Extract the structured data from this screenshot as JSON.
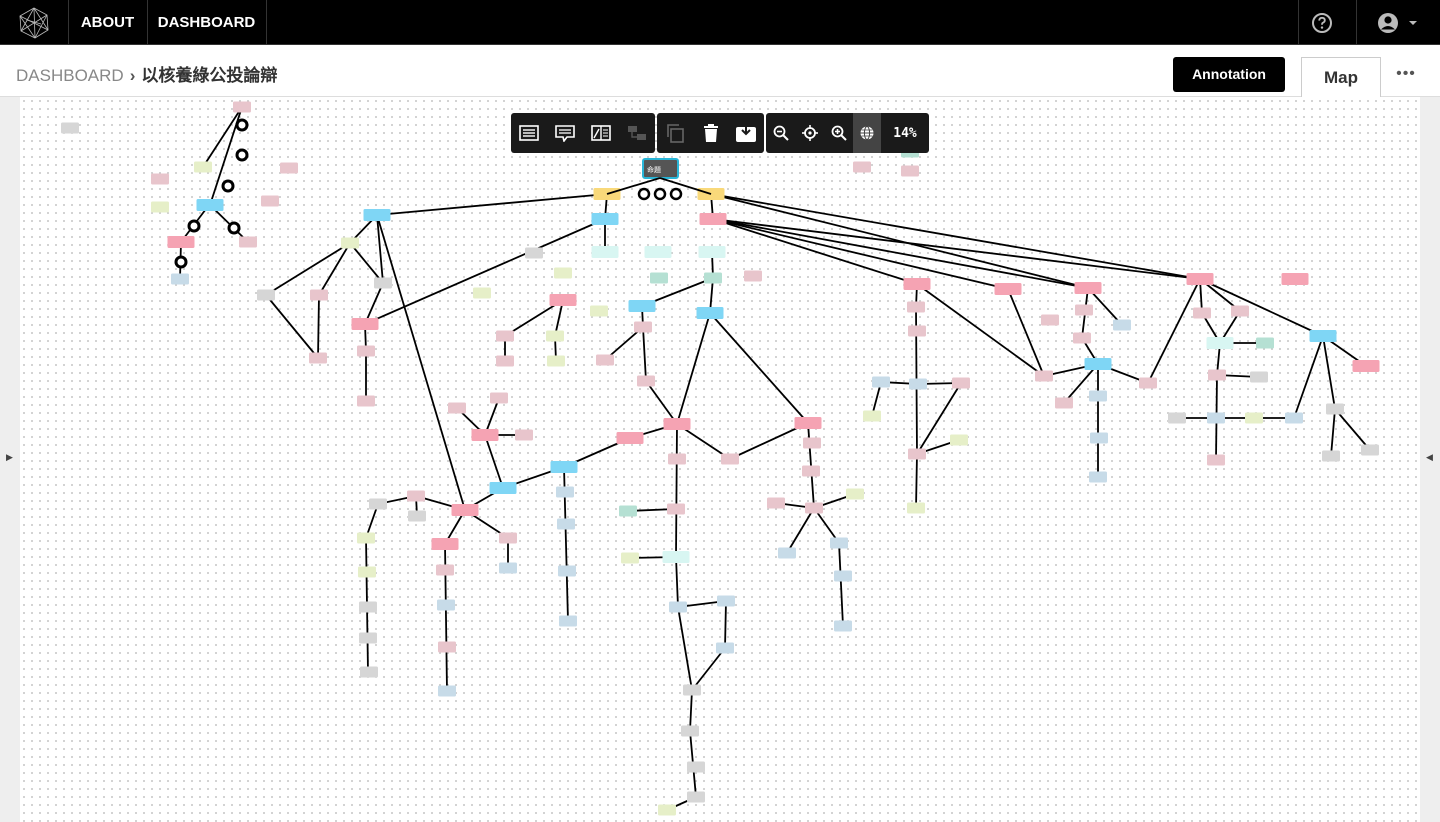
{
  "nav": {
    "logo": "network-logo-icon",
    "items": [
      {
        "label": "ABOUT"
      },
      {
        "label": "DASHBOARD"
      }
    ],
    "help_icon": "question-circle-icon",
    "user_icon": "user-circle-icon"
  },
  "breadcrumb": {
    "root": "DASHBOARD",
    "separator": "›",
    "current": "以核養綠公投論辯"
  },
  "actions": {
    "annotation_label": "Annotation",
    "map_tab_label": "Map",
    "more_label": "•••"
  },
  "toolbar": {
    "edit_tools": [
      "card-view-icon",
      "comment-icon",
      "split-view-icon",
      "link-tool-icon"
    ],
    "action_tools": [
      "copy-icon",
      "trash-icon",
      "export-icon"
    ],
    "zoom_tools": [
      "zoom-out-icon",
      "center-icon",
      "zoom-in-icon",
      "globe-icon"
    ],
    "zoom_level": "14%"
  },
  "map": {
    "selected_node_label": "命題",
    "colors": {
      "yellow": "#f9d97a",
      "blue": "#7fd6f5",
      "pink": "#f5a3b3",
      "light_pink": "#e8c5cc",
      "light_green": "#e6efc8",
      "light_blue": "#c7dbe8",
      "gray": "#d6d6d6",
      "mint": "#b5e0d3",
      "cyan_light": "#d8f6f2"
    }
  }
}
